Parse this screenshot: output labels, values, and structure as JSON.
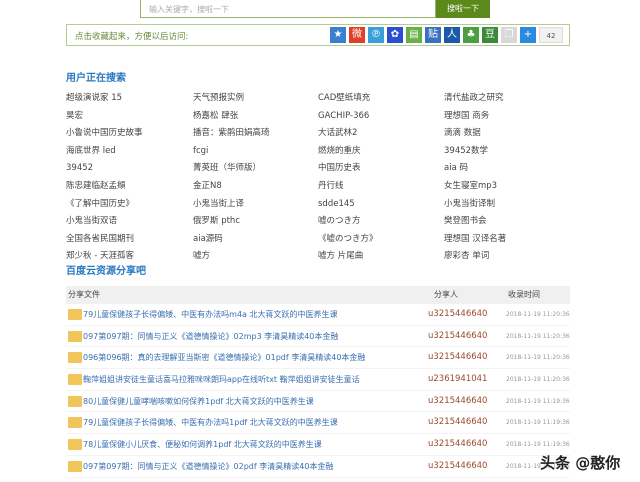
{
  "search": {
    "placeholder": "输入关键字，搜啦一下",
    "button": "搜啦一下"
  },
  "bookmark": {
    "text": "点击收藏起来，方便以后访问:",
    "count": "42",
    "icons": [
      {
        "name": "qzone-icon",
        "color": "#3a7fd0",
        "glyph": "★"
      },
      {
        "name": "weibo-icon",
        "color": "#e0402a",
        "glyph": "微"
      },
      {
        "name": "tencent-weibo-icon",
        "color": "#3aa0d8",
        "glyph": "℗"
      },
      {
        "name": "baidu-icon",
        "color": "#2a50d0",
        "glyph": "✿"
      },
      {
        "name": "pic-icon",
        "color": "#6ab04a",
        "glyph": "▤"
      },
      {
        "name": "tieba-icon",
        "color": "#3a70c0",
        "glyph": "贴"
      },
      {
        "name": "renren-icon",
        "color": "#1a5aa8",
        "glyph": "人"
      },
      {
        "name": "kaixin-icon",
        "color": "#4aa040",
        "glyph": "♣"
      },
      {
        "name": "douban-icon",
        "color": "#3a8a3a",
        "glyph": "豆"
      },
      {
        "name": "copy-icon",
        "color": "#d8d8d8",
        "glyph": "❐"
      },
      {
        "name": "more-icon",
        "color": "#2a8ae0",
        "glyph": "+"
      }
    ]
  },
  "searching": {
    "title": "用户正在搜索",
    "items": [
      "超级演说家 15",
      "天气预报实例",
      "CAD壁纸填充",
      "清代盐政之研究",
      "昊宏",
      "杨嘉松 肆张",
      "GACHIP-366",
      "理想国 商务",
      "小鲁说中国历史故事",
      "播音：紫鹃田娟高琦",
      "大话武林2",
      "滴滴 数据",
      "海底世界 led",
      "fcgi",
      "燃烧的重庆",
      "39452数学",
      "39452",
      "菁英班（华师版）",
      "中国历史表",
      "aia 码",
      "陈忠建临赵孟頫",
      "金正N8",
      "丹行线",
      "女生寝室mp3",
      "《了解中国历史》",
      "小鬼当街上译",
      "sdde145",
      "小鬼当街译制",
      "小鬼当街双语",
      "俄罗斯 pthc",
      "嘘のつき方",
      "樊登图书会",
      "全国各省民国期刊",
      "aia源码",
      "《嘘のつき方》",
      "理想国 汉译名著",
      "郑少秋 - 天涯孤客",
      "嘘方",
      "嘘方 片尾曲",
      "廖彩杏 单词"
    ]
  },
  "share": {
    "title": "百度云资源分享吧",
    "headers": [
      "分享文件",
      "分享人",
      "收录时间"
    ],
    "rows": [
      {
        "name": "79儿童保健孩子长得偏矮、中医有办法吗m4a 北大蒋文跃的中医养生课",
        "user": "u3215446640",
        "time": "2018-11-19 11:20:36"
      },
      {
        "name": "097第097期：同情与正义《道德情操论》02mp3 李清昊精读40本金融",
        "user": "u3215446640",
        "time": "2018-11-19 11:20:36"
      },
      {
        "name": "096第096期：真的去理解亚当斯密《道德情操论》01pdf 李清昊精读40本金融",
        "user": "u3215446640",
        "time": "2018-11-19 11:20:36"
      },
      {
        "name": "鞠萍姐姐讲安徒生童话喜马拉雅咪咪朗玛app在线听txt 鞠萍姐姐讲安徒生童话",
        "user": "u2361941041",
        "time": "2018-11-19 11:20:36"
      },
      {
        "name": "80儿童保健儿童哮喘咳嗽如何保养1pdf 北大蒋文跃的中医养生课",
        "user": "u3215446640",
        "time": "2018-11-19 11:19:36"
      },
      {
        "name": "79儿童保健孩子长得偏矮、中医有办法吗1pdf 北大蒋文跃的中医养生课",
        "user": "u3215446640",
        "time": "2018-11-19 11:19:36"
      },
      {
        "name": "78儿童保健小儿厌食、便秘如何调养1pdf 北大蒋文跃的中医养生课",
        "user": "u3215446640",
        "time": "2018-11-19 11:19:36"
      },
      {
        "name": "097第097期：同情与正义《道德情操论》02pdf 李清昊精读40本金融",
        "user": "u3215446640",
        "time": "2018-11-19 11:19:36"
      }
    ]
  },
  "watermark": "头条 @憨你"
}
